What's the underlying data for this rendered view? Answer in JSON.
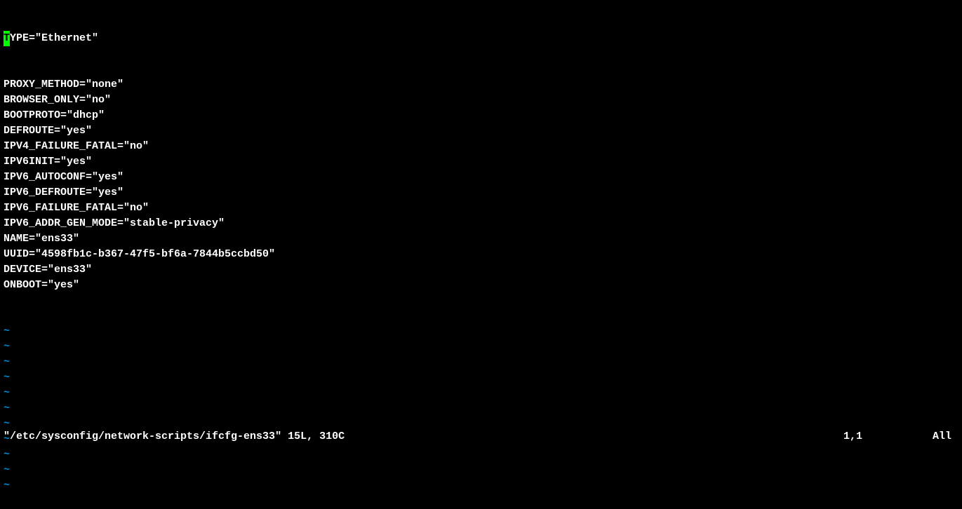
{
  "editor": {
    "cursor_char": "T",
    "first_line_remainder": "YPE=\"Ethernet\"",
    "lines": [
      "PROXY_METHOD=\"none\"",
      "BROWSER_ONLY=\"no\"",
      "BOOTPROTO=\"dhcp\"",
      "DEFROUTE=\"yes\"",
      "IPV4_FAILURE_FATAL=\"no\"",
      "IPV6INIT=\"yes\"",
      "IPV6_AUTOCONF=\"yes\"",
      "IPV6_DEFROUTE=\"yes\"",
      "IPV6_FAILURE_FATAL=\"no\"",
      "IPV6_ADDR_GEN_MODE=\"stable-privacy\"",
      "NAME=\"ens33\"",
      "UUID=\"4598fb1c-b367-47f5-bf6a-7844b5ccbd50\"",
      "DEVICE=\"ens33\"",
      "ONBOOT=\"yes\""
    ],
    "tilde": "~",
    "tilde_count": 11
  },
  "status": {
    "file_info": "\"/etc/sysconfig/network-scripts/ifcfg-ens33\" 15L, 310C",
    "position": "1,1",
    "scroll": "All"
  }
}
